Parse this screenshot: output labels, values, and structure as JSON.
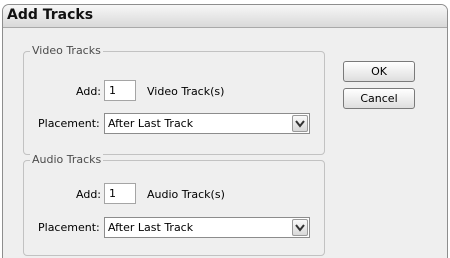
{
  "window": {
    "title": "Add Tracks"
  },
  "video": {
    "group_label": "Video Tracks",
    "add_label": "Add:",
    "count_value": "1",
    "unit_label": "Video Track(s)",
    "placement_label": "Placement:",
    "placement_value": "After Last Track"
  },
  "audio": {
    "group_label": "Audio Tracks",
    "add_label": "Add:",
    "count_value": "1",
    "unit_label": "Audio Track(s)",
    "placement_label": "Placement:",
    "placement_value": "After Last Track"
  },
  "buttons": {
    "ok": "OK",
    "cancel": "Cancel"
  },
  "icons": {
    "dropdown": "chevron-down-icon"
  }
}
